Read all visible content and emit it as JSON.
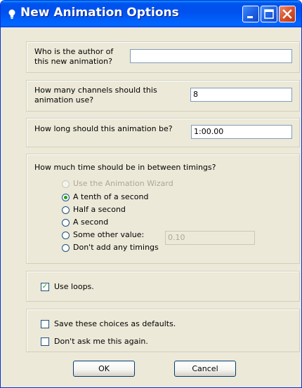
{
  "window": {
    "title": "New Animation Options"
  },
  "author": {
    "label": "Who is the author of this new animation?",
    "value": ""
  },
  "channels": {
    "label": "How many channels should this animation use?",
    "value": "8"
  },
  "length": {
    "label": "How long should this animation be?",
    "value": "1:00.00"
  },
  "timings": {
    "heading": "How much time should be in between timings?",
    "options": [
      {
        "label": "Use the Animation Wizard",
        "checked": false,
        "enabled": false
      },
      {
        "label": "A tenth of a second",
        "checked": true,
        "enabled": true
      },
      {
        "label": "Half a second",
        "checked": false,
        "enabled": true
      },
      {
        "label": "A second",
        "checked": false,
        "enabled": true
      },
      {
        "label": "Some other value:",
        "checked": false,
        "enabled": true
      },
      {
        "label": "Don't add any timings",
        "checked": false,
        "enabled": true
      }
    ],
    "other_value": "0.10"
  },
  "loops": {
    "label": "Use loops.",
    "checked": true
  },
  "defaults": {
    "save_label": "Save these choices as defaults.",
    "save_checked": false,
    "dont_ask_label": "Don't ask me this again.",
    "dont_ask_checked": false
  },
  "buttons": {
    "ok": "OK",
    "cancel": "Cancel"
  },
  "colors": {
    "titlebar": "#0054e3",
    "dialog_bg": "#ece9d8",
    "radio_dot": "#21a121"
  },
  "icons": {
    "title": "bulb-icon",
    "minimize": "minimize-icon",
    "maximize": "maximize-icon",
    "close": "close-icon"
  }
}
